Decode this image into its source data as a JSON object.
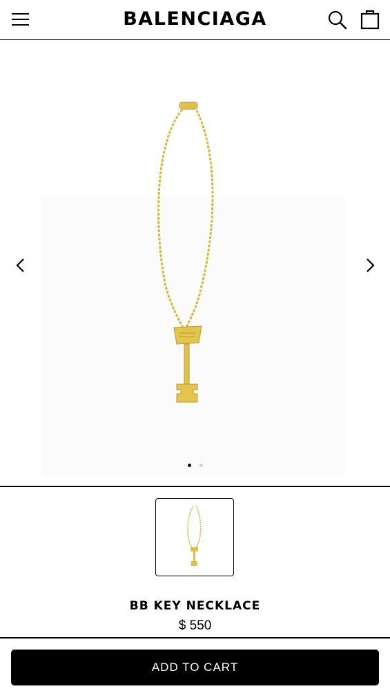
{
  "header": {
    "brand": "BALENCIAGA",
    "icons": [
      "menu-icon",
      "search-icon",
      "shopping-bag-icon"
    ]
  },
  "gallery": {
    "icons": [
      "chevron-left-icon",
      "chevron-right-icon"
    ],
    "active_slide": 1,
    "slide_count": 2
  },
  "product": {
    "name": "BB KEY NECKLACE",
    "price": "$ 550",
    "accent_color": "#d9b93a"
  },
  "cart": {
    "button_label": "ADD TO CART"
  }
}
